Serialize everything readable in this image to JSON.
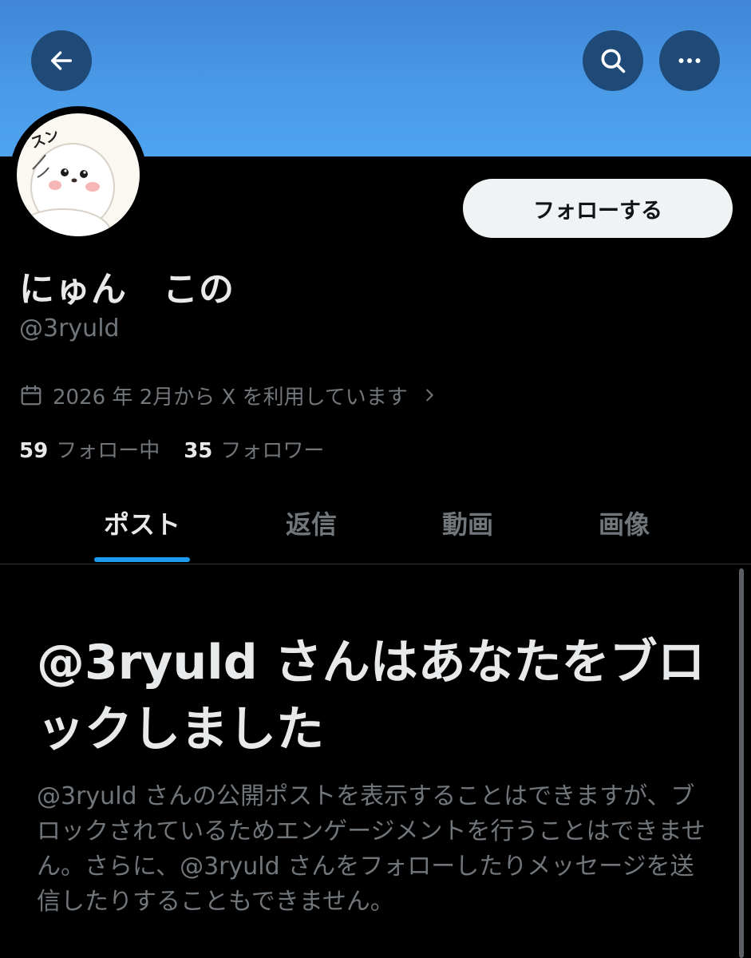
{
  "header": {
    "back_icon": "arrow-left-icon",
    "search_icon": "search-icon",
    "more_icon": "more-horizontal-icon",
    "banner_color": "#4a9be8"
  },
  "profile": {
    "avatar_text": "スン",
    "display_name": "にゅん　この",
    "handle": "@3ryuld",
    "joined": "2026 年 2月から X を利用しています",
    "follow_label": "フォローする",
    "following_count": "59",
    "following_label": "フォロー中",
    "followers_count": "35",
    "followers_label": "フォロワー"
  },
  "tabs": [
    {
      "label": "ポスト",
      "active": true
    },
    {
      "label": "返信",
      "active": false
    },
    {
      "label": "動画",
      "active": false
    },
    {
      "label": "画像",
      "active": false
    }
  ],
  "blocked": {
    "title": "@3ryuld さんはあなたをブロックしました",
    "description": "@3ryuld さんの公開ポストを表示することはできますが、ブロックされているためエンゲージメントを行うことはできません。さらに、@3ryuld さんをフォローしたりメッセージを送信したりすることもできません。"
  },
  "colors": {
    "accent": "#1d9bf0",
    "text_primary": "#e7e9ea",
    "text_secondary": "#71767b",
    "background": "#000000"
  }
}
